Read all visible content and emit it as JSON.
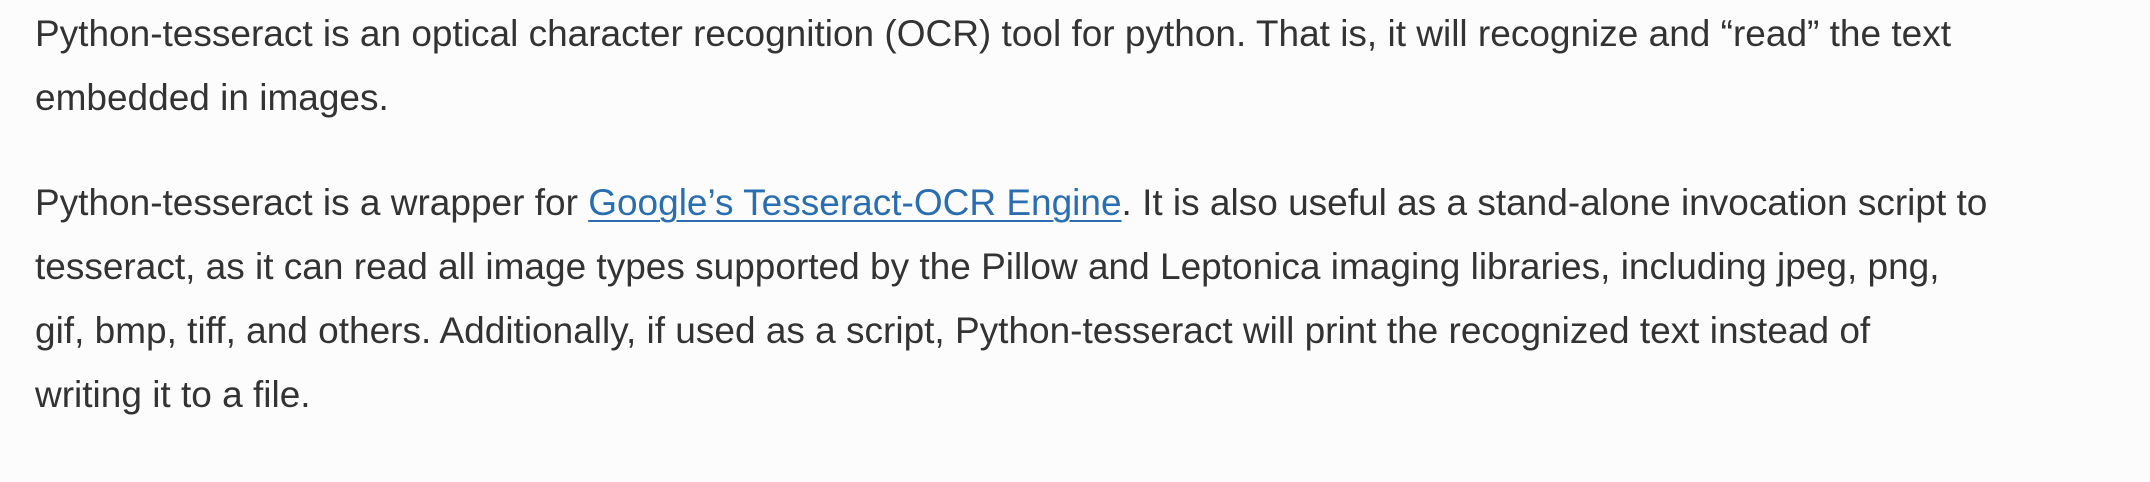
{
  "article": {
    "paragraph1": {
      "line1": "Python-tesseract is an optical character recognition (OCR) tool for python. That is, it will recognize and “read” the text",
      "line2": "embedded in images."
    },
    "paragraph2": {
      "line1_before": "Python-tesseract is a wrapper for ",
      "link_text": "Google’s Tesseract-OCR Engine",
      "line1_after": ". It is also useful as a stand-alone invocation script to",
      "line2": "tesseract, as it can read all image types supported by the Pillow and Leptonica imaging libraries, including jpeg, png,",
      "line3": "gif, bmp, tiff, and others. Additionally, if used as a script, Python-tesseract will print the recognized text instead of",
      "line4": "writing it to a file."
    }
  },
  "colors": {
    "text": "#333333",
    "link": "#2a6eb0",
    "background": "#fcfcfc"
  }
}
